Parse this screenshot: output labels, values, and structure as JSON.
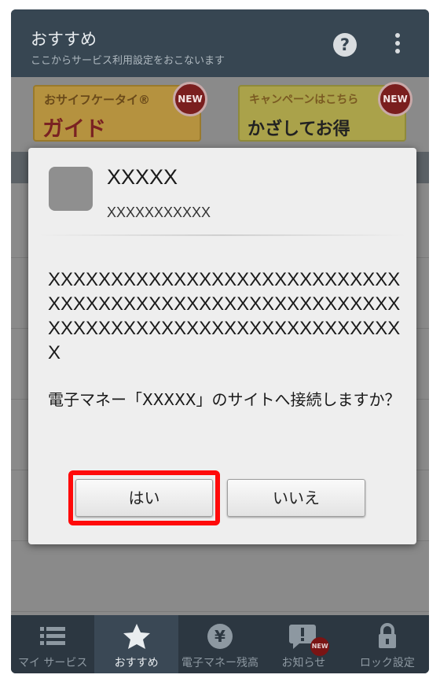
{
  "header": {
    "title": "おすすめ",
    "subtitle": "ここからサービス利用設定をおこないます",
    "help_icon": "help-icon",
    "more_icon": "more-vert-icon"
  },
  "banners": [
    {
      "line1": "おサイフケータイ®",
      "line2": "ガイド",
      "badge": "NEW"
    },
    {
      "line1": "キャンペーンはこちら",
      "line2": "かざしてお得",
      "badge": "NEW"
    }
  ],
  "dialog": {
    "app_name": "XXXXX",
    "app_id": "XXXXXXXXXXX",
    "body": "XXXXXXXXXXXXXXXXXXXXXXXXXXXXXXXXXXXXXXXXXXXXXXXXXXXXXXXXXXXXXXXXXXXXXXXXXXXXXXXXXXXXX",
    "question": "電子マネー「XXXXX」のサイトへ接続しますか？",
    "yes_label": "はい",
    "no_label": "いいえ"
  },
  "bottom_nav": [
    {
      "label": "マイ サービス",
      "icon": "list-icon"
    },
    {
      "label": "おすすめ",
      "icon": "star-icon"
    },
    {
      "label": "電子マネー残高",
      "icon": "yen-icon"
    },
    {
      "label": "お知らせ",
      "icon": "notification-icon",
      "badge": "NEW"
    },
    {
      "label": "ロック設定",
      "icon": "lock-icon"
    }
  ],
  "colors": {
    "highlight": "#ff0a0a",
    "app_bar": "#374652"
  }
}
